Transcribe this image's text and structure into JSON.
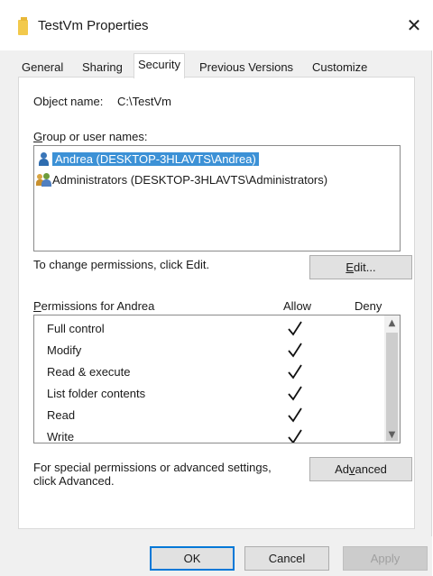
{
  "window": {
    "title": "TestVm Properties",
    "close_glyph": "✕"
  },
  "tabs": [
    {
      "label": "General"
    },
    {
      "label": "Sharing"
    },
    {
      "label": "Security"
    },
    {
      "label": "Previous Versions"
    },
    {
      "label": "Customize"
    }
  ],
  "active_tab": "Security",
  "object": {
    "label": "Object name:",
    "value": "C:\\TestVm"
  },
  "groups": {
    "label_accel": "G",
    "label_rest": "roup or user names:",
    "items": [
      {
        "name": "Andrea (DESKTOP-3HLAVTS\\Andrea)",
        "icon": "user-icon",
        "selected": true
      },
      {
        "name": "Administrators (DESKTOP-3HLAVTS\\Administrators)",
        "icon": "group-icon",
        "selected": false
      }
    ]
  },
  "change_hint": "To change permissions, click Edit.",
  "edit_button": {
    "accel": "E",
    "rest": "dit..."
  },
  "permissions": {
    "header_accel": "P",
    "header_rest": "ermissions for Andrea",
    "allow_label": "Allow",
    "deny_label": "Deny",
    "rows": [
      {
        "name": "Full control",
        "allow": true,
        "deny": false
      },
      {
        "name": "Modify",
        "allow": true,
        "deny": false
      },
      {
        "name": "Read & execute",
        "allow": true,
        "deny": false
      },
      {
        "name": "List folder contents",
        "allow": true,
        "deny": false
      },
      {
        "name": "Read",
        "allow": true,
        "deny": false
      },
      {
        "name": "Write",
        "allow": true,
        "deny": false
      }
    ]
  },
  "advanced": {
    "hint_line1": "For special permissions or advanced settings,",
    "hint_line2": "click Advanced.",
    "button_pre": "Ad",
    "button_accel": "v",
    "button_post": "anced"
  },
  "footer": {
    "ok": "OK",
    "cancel": "Cancel",
    "apply": "Apply"
  },
  "colors": {
    "selection": "#3c91d6",
    "window_bg": "#f0f0f0",
    "panel_bg": "#ffffff"
  }
}
